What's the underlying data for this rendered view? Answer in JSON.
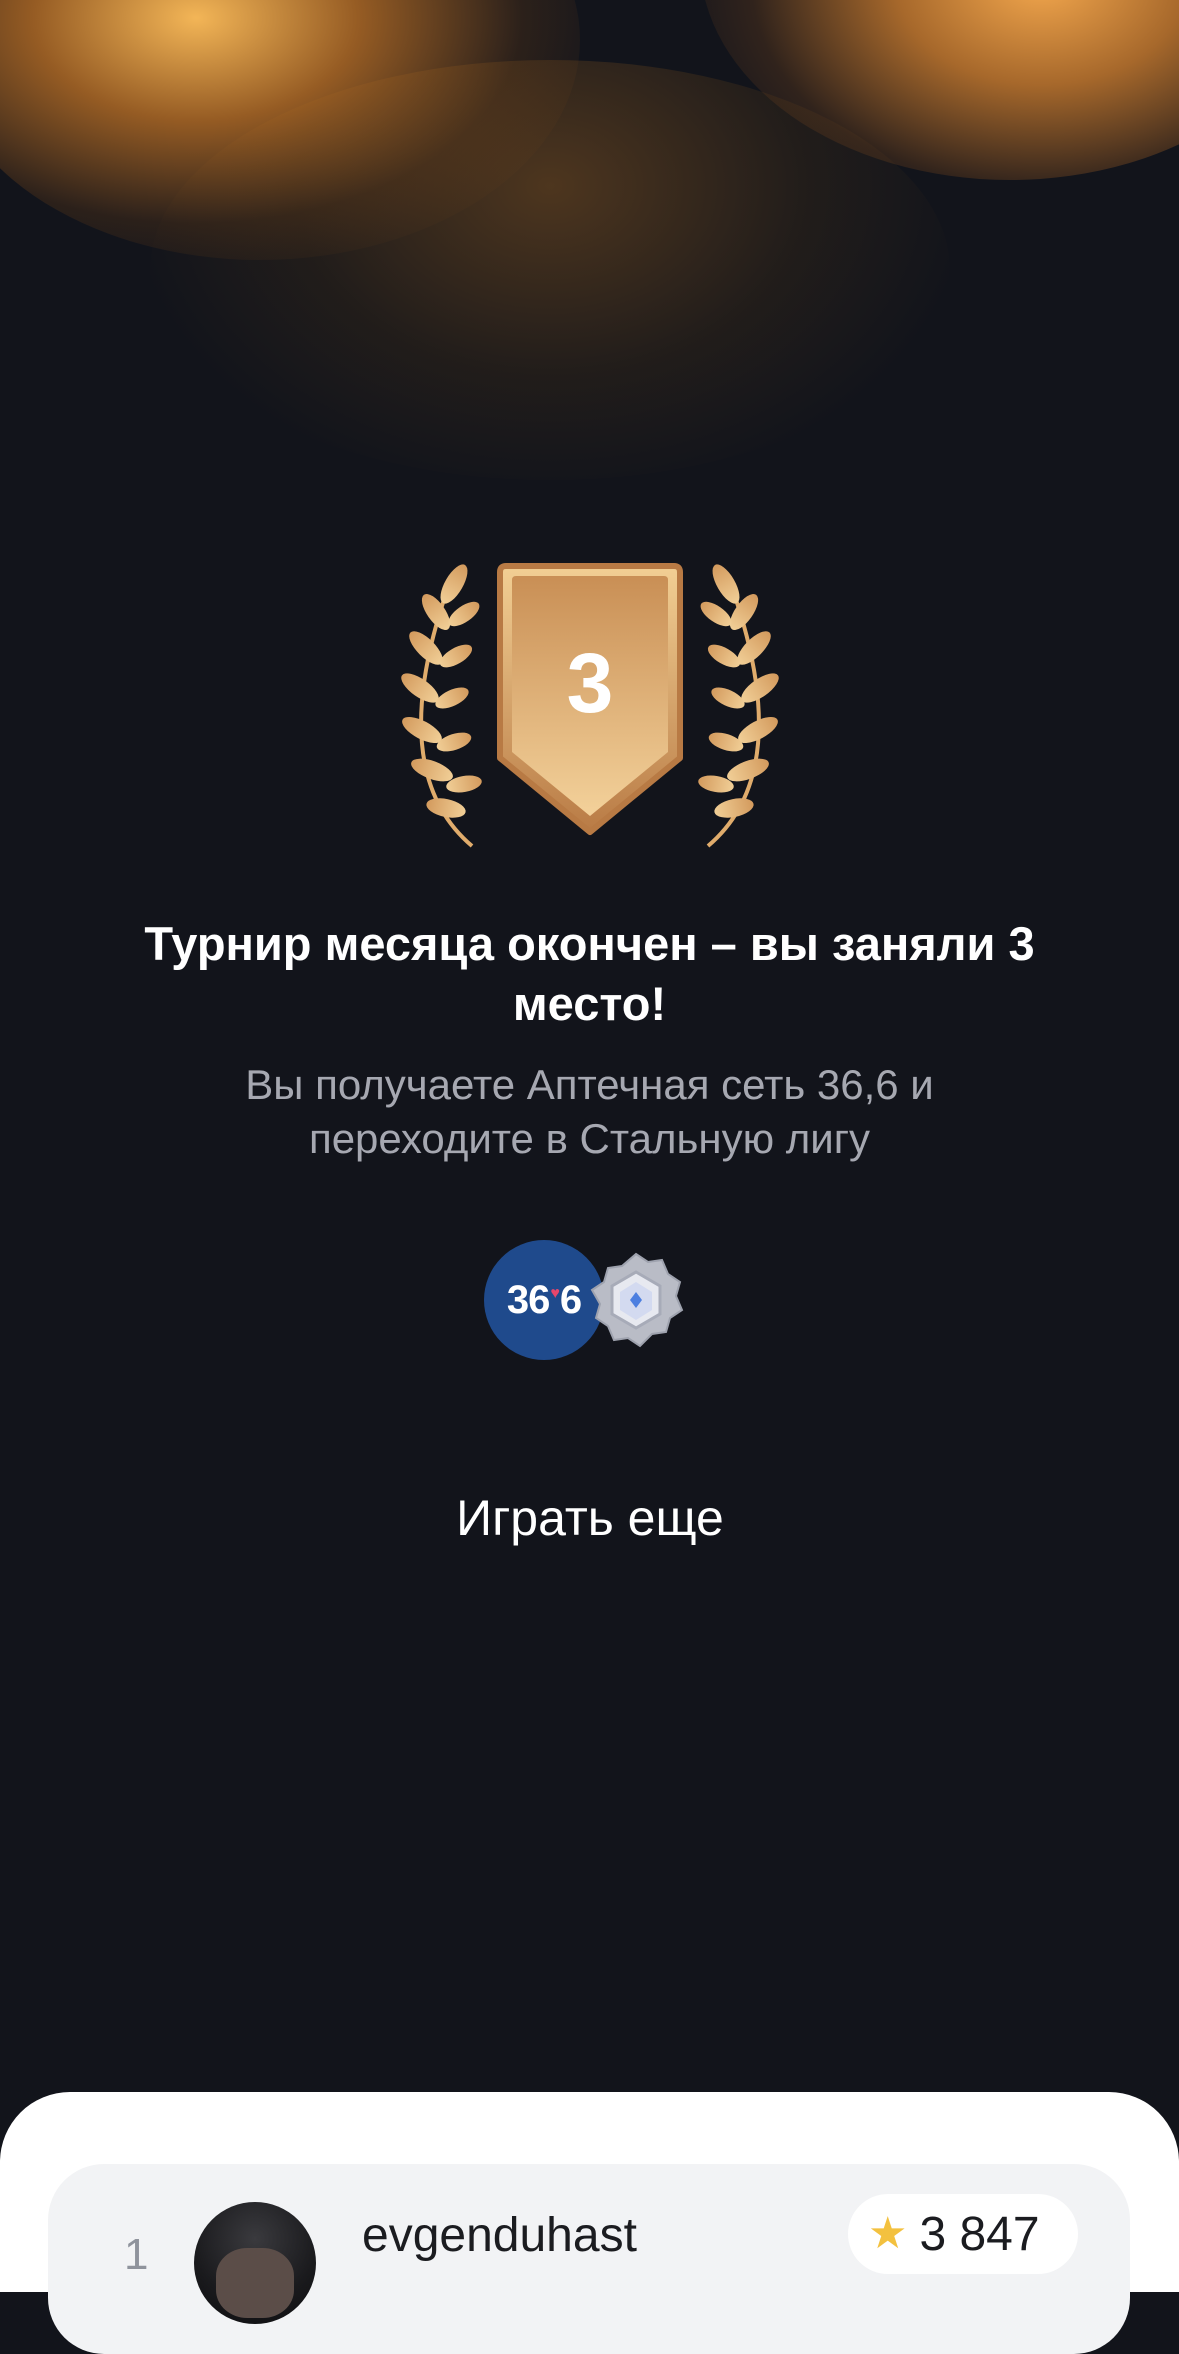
{
  "header": {
    "place_number": "3"
  },
  "result": {
    "title": "Турнир месяца окончен – вы заняли 3 место!",
    "subtitle": "Вы получаете Аптечная сеть 36,6 и переходите в Стальную лигу"
  },
  "rewards": {
    "pharmacy_logo_text_left": "36",
    "pharmacy_logo_text_right": "6",
    "pharmacy_logo_icon": "heart-dot-icon",
    "league_icon": "steel-league-badge-icon"
  },
  "actions": {
    "play_again_label": "Играть еще"
  },
  "leaderboard": {
    "rows": [
      {
        "rank": "1",
        "username": "evgenduhast",
        "score": "3 847",
        "score_icon": "star-icon"
      }
    ]
  },
  "colors": {
    "background": "#12141b",
    "accent_gold": "#e7b36f",
    "pharmacy_blue": "#1f4a8c",
    "star": "#f3c13f"
  }
}
